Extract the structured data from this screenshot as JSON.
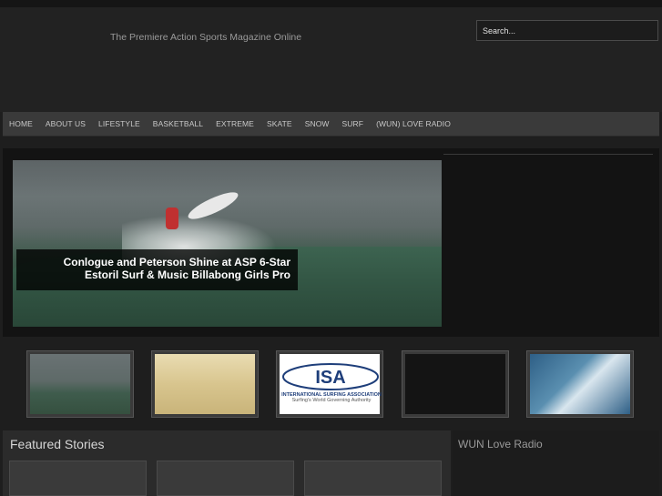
{
  "header": {
    "tagline": "The Premiere Action Sports Magazine Online"
  },
  "search": {
    "placeholder": "Search..."
  },
  "nav": {
    "items": [
      "HOME",
      "ABOUT US",
      "LIFESTYLE",
      "BASKETBALL",
      "EXTREME",
      "SKATE",
      "SNOW",
      "SURF",
      "(WUN) LOVE RADIO"
    ]
  },
  "slider": {
    "caption_line1": "Conlogue and Peterson Shine at ASP 6-Star",
    "caption_line2": "Estoril Surf & Music Billabong Girls Pro"
  },
  "thumbnails": {
    "isa_logo_text": "ISA",
    "isa_banner": "INTERNATIONAL SURFING ASSOCIATION",
    "isa_subtitle": "Surfing's World Governing Authority"
  },
  "featured": {
    "title": "Featured Stories"
  },
  "sidebar": {
    "radio_title": "WUN Love Radio"
  }
}
